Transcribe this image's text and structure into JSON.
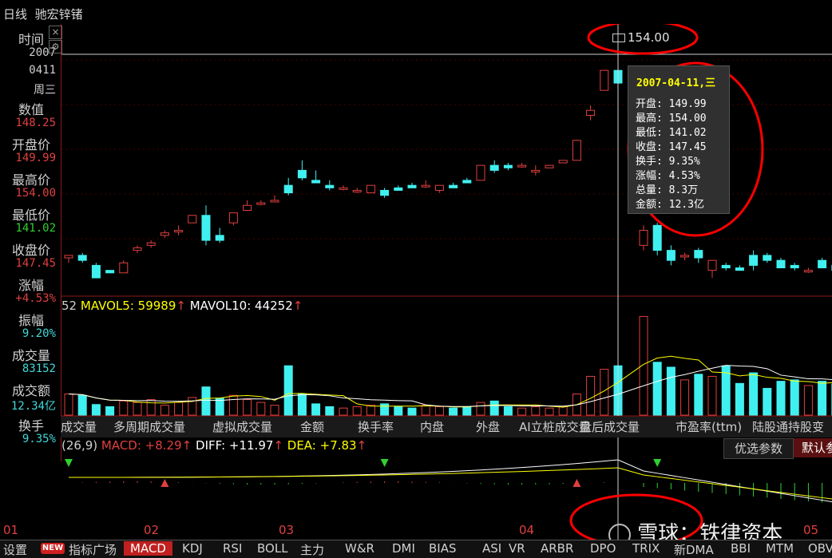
{
  "header": {
    "period": "日线",
    "stock_name": "驰宏锌锗"
  },
  "sidebar": {
    "items": [
      {
        "label": "时间",
        "value": "2007",
        "value2": "0411",
        "value3": "周三",
        "color": "#d0d0d0"
      },
      {
        "label": "数值",
        "value": "148.25",
        "color": "#e04040"
      },
      {
        "label": "开盘价",
        "value": "149.99",
        "color": "#e04040"
      },
      {
        "label": "最高价",
        "value": "154.00",
        "color": "#e04040"
      },
      {
        "label": "最低价",
        "value": "141.02",
        "color": "#30d030"
      },
      {
        "label": "收盘价",
        "value": "147.45",
        "color": "#e04040"
      },
      {
        "label": "涨幅",
        "value": "+4.53%",
        "color": "#e04040"
      },
      {
        "label": "振幅",
        "value": "9.20%",
        "color": "#40d8d8"
      },
      {
        "label": "成交量",
        "value": "83152",
        "color": "#40d8d8"
      },
      {
        "label": "成交额",
        "value": "12.34亿",
        "color": "#40d8d8"
      },
      {
        "label": "换手",
        "value": "9.35%",
        "color": "#40d8d8"
      }
    ]
  },
  "price_marker": "154.00",
  "tooltip": {
    "date": "2007-04-11,三",
    "rows": [
      "开盘: 149.99",
      "最高: 154.00",
      "最低: 141.02",
      "收盘: 147.45",
      "换手: 9.35%",
      "涨幅: 4.53%",
      "总量: 8.3万",
      "金额: 12.3亿"
    ]
  },
  "volume_header": {
    "prefix": "52",
    "mavol5": "MAVOL5: 59989",
    "mavol10": "MAVOL10: 44252"
  },
  "indicator_tabs": [
    "成交量",
    "多周期成交量",
    "虚拟成交量",
    "金额",
    "换手率",
    "内盘",
    "外盘",
    "AI立桩成交量",
    "盘后成交量",
    "市盈率(ttm)",
    "陆股通持股变"
  ],
  "macd_header": {
    "prefix": "(26,9)",
    "macd": "MACD: +8.29",
    "diff": "DIFF: +11.97",
    "dea": "DEA: +7.83"
  },
  "option_buttons": {
    "preferred": "优选参数",
    "default": "默认参"
  },
  "x_axis": [
    "01",
    "02",
    "03",
    "04",
    "05"
  ],
  "bottom_tabs": [
    "设置",
    "NEW",
    "指标广场",
    "MACD",
    "KDJ",
    "RSI",
    "BOLL",
    "主力",
    "W&R",
    "DMI",
    "BIAS",
    "ASI",
    "VR",
    "ARBR",
    "DPO",
    "TRIX",
    "新DMA",
    "BBI",
    "MTM",
    "OBV"
  ],
  "watermark": "雪球：铁律资本",
  "colors": {
    "up": "#e04040",
    "down": "#40f0f0",
    "ma_white": "#ffffff",
    "ma_yellow": "#ffff00",
    "annot": "#ff0000"
  },
  "chart_data": {
    "type": "candlestick",
    "candles": [
      [
        112.5,
        113,
        111.5,
        113
      ],
      [
        113,
        113.5,
        111.5,
        112
      ],
      [
        111,
        111.5,
        108.5,
        108.5
      ],
      [
        110,
        110,
        109.5,
        109.5
      ],
      [
        109.5,
        112,
        109.5,
        111.5
      ],
      [
        114,
        115,
        113.5,
        114.5
      ],
      [
        115,
        116,
        114.5,
        115.5
      ],
      [
        117,
        118,
        116.5,
        117.5
      ],
      [
        118,
        119,
        117,
        118
      ],
      [
        119.5,
        121,
        119.5,
        121
      ],
      [
        121,
        123,
        115,
        116
      ],
      [
        117,
        118.5,
        115.5,
        116
      ],
      [
        119.5,
        121.5,
        119,
        121.5
      ],
      [
        122,
        124,
        122,
        123
      ],
      [
        123.5,
        124,
        123,
        123.5
      ],
      [
        124,
        125,
        124,
        124
      ],
      [
        127,
        128.5,
        125,
        125.5
      ],
      [
        130,
        132,
        128,
        128.5
      ],
      [
        128,
        130,
        127.5,
        127.5
      ],
      [
        127,
        128,
        126,
        126.5
      ],
      [
        126.5,
        127,
        126,
        126.5
      ],
      [
        126,
        126.5,
        125.5,
        126
      ],
      [
        125.5,
        127,
        125.5,
        127
      ],
      [
        126,
        126.5,
        124.5,
        125
      ],
      [
        126.5,
        127,
        126,
        126
      ],
      [
        127,
        127.5,
        126.5,
        126.5
      ],
      [
        127,
        128,
        126.5,
        127
      ],
      [
        126,
        127,
        125.5,
        127
      ],
      [
        127,
        127.5,
        126.5,
        126.5
      ],
      [
        128,
        128.5,
        127.5,
        127.5
      ],
      [
        128,
        131,
        128,
        131
      ],
      [
        131,
        132,
        129.5,
        130
      ],
      [
        131,
        131.5,
        130,
        130.5
      ],
      [
        131,
        131.5,
        130.5,
        131
      ],
      [
        130,
        131,
        129,
        130
      ],
      [
        130.5,
        131,
        130.5,
        131
      ],
      [
        131.5,
        132,
        131.5,
        132
      ],
      [
        132,
        136,
        132,
        136
      ],
      [
        141,
        143,
        140,
        142
      ],
      [
        146,
        150,
        146,
        150
      ],
      [
        149.99,
        154,
        141.02,
        147.45
      ],
      [
        115,
        119,
        114,
        118
      ],
      [
        119,
        119.5,
        113,
        114
      ],
      [
        114,
        115,
        111,
        112
      ],
      [
        113,
        113.5,
        112,
        113
      ],
      [
        114,
        114.5,
        111.5,
        112.5
      ],
      [
        110,
        112,
        108.5,
        112
      ],
      [
        111,
        111.5,
        110,
        110.5
      ],
      [
        110.5,
        111,
        110,
        110
      ],
      [
        113,
        114,
        110,
        111
      ],
      [
        113,
        113.5,
        111.5,
        112
      ],
      [
        112,
        112.5,
        110.5,
        110.5
      ],
      [
        111,
        111.5,
        110,
        110.5
      ],
      [
        110,
        110.5,
        109.5,
        110
      ],
      [
        112,
        112.5,
        110.5,
        110.5
      ],
      [
        111,
        111.5,
        110,
        110
      ],
      [
        110,
        110.5,
        108,
        109
      ]
    ],
    "volumes": [
      30,
      28,
      15,
      12,
      20,
      18,
      22,
      14,
      18,
      25,
      40,
      24,
      28,
      22,
      18,
      14,
      70,
      30,
      16,
      12,
      10,
      12,
      14,
      16,
      12,
      10,
      14,
      12,
      10,
      12,
      18,
      20,
      12,
      10,
      12,
      10,
      12,
      30,
      55,
      65,
      70,
      140,
      75,
      68,
      50,
      58,
      55,
      70,
      45,
      60,
      38,
      48,
      50,
      42,
      48,
      44,
      50
    ],
    "ylim": [
      105,
      158
    ]
  }
}
